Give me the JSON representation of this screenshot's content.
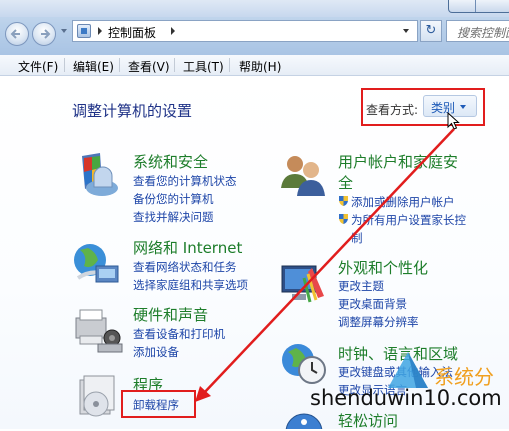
{
  "nav": {
    "breadcrumb": "控制面板",
    "search_placeholder": "搜索控制面"
  },
  "menu": {
    "file": "文件(F)",
    "edit": "编辑(E)",
    "view": "查看(V)",
    "tools": "工具(T)",
    "help": "帮助(H)"
  },
  "header": {
    "title": "调整计算机的设置",
    "view_by_label": "查看方式:",
    "view_by_value": "类别"
  },
  "categories": {
    "system_security": {
      "title": "系统和安全",
      "links": [
        "查看您的计算机状态",
        "备份您的计算机",
        "查找并解决问题"
      ]
    },
    "network": {
      "title": "网络和 Internet",
      "links": [
        "查看网络状态和任务",
        "选择家庭组和共享选项"
      ]
    },
    "hardware": {
      "title": "硬件和声音",
      "links": [
        "查看设备和打印机",
        "添加设备"
      ]
    },
    "programs": {
      "title": "程序",
      "links": [
        "卸载程序"
      ]
    },
    "user_accounts": {
      "title_line1": "用户帐户和家庭安",
      "title_line2": "全",
      "links": [
        "添加或删除用户帐户",
        "为所有用户设置家长控",
        "制"
      ]
    },
    "appearance": {
      "title": "外观和个性化",
      "links": [
        "更改主题",
        "更改桌面背景",
        "调整屏幕分辨率"
      ]
    },
    "clock": {
      "title": "时钟、语言和区域",
      "links": [
        "更改键盘或其他输入法",
        "更改显示语言"
      ]
    },
    "ease": {
      "title": "轻松访问"
    }
  },
  "watermark": {
    "text": "shenduwin10.com",
    "brand": "系统分"
  },
  "colors": {
    "category_title": "#1d7d2a",
    "link": "#1e46a8",
    "highlight_box": "#e11d1d"
  }
}
